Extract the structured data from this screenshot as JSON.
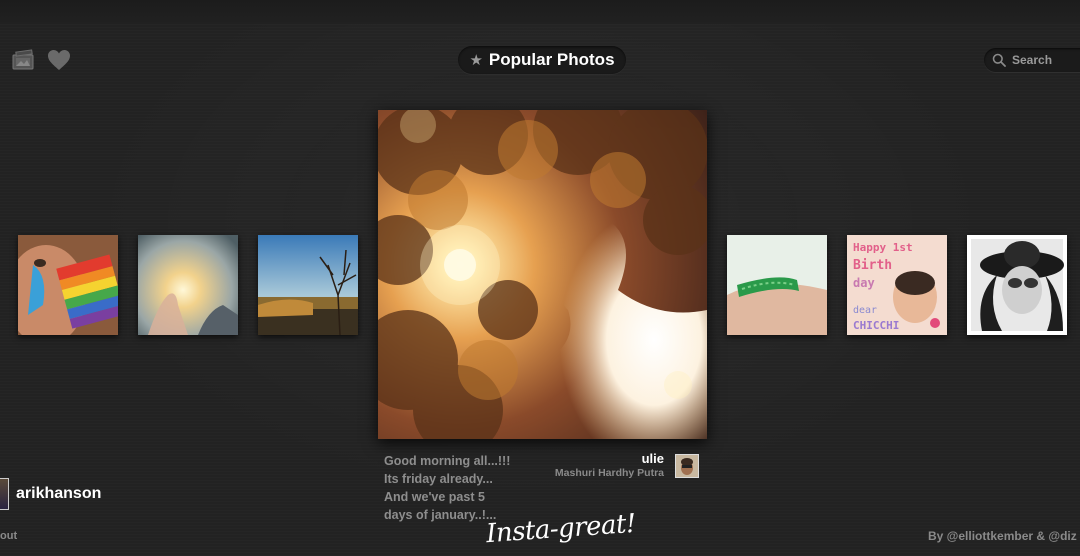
{
  "header": {
    "title": "Popular Photos",
    "search_placeholder": "Search",
    "icons": [
      "photo-stack-icon",
      "heart-icon",
      "star-icon",
      "magnifier-icon"
    ]
  },
  "thumbnails_left": [
    {
      "subject": "face painted with rainbow"
    },
    {
      "subject": "hand holding sunlight"
    },
    {
      "subject": "autumn tree by water"
    }
  ],
  "main_photo": {
    "subject": "sunlight through tree canopy",
    "caption_lines": [
      "Good morning all...!!!",
      "Its friday already...",
      "And we've past 5",
      "days of january..!..."
    ],
    "owner_username": "ulie",
    "owner_fullname": "Mashuri Hardhy Putra"
  },
  "thumbnails_right": [
    {
      "subject": "arm with green bracelet"
    },
    {
      "subject": "birthday baby photo",
      "overlay_text": "Happy 1st Birth day dear CHICCHI"
    },
    {
      "subject": "woman in hat black and white"
    }
  ],
  "previous_user": "arikhanson",
  "footer": {
    "about_link": "out",
    "logo_text": "Insta-great!",
    "credits": "By @elliottkember & @diz"
  },
  "colors": {
    "background": "#222222",
    "text": "#ffffff",
    "muted": "#8a8a8a"
  }
}
